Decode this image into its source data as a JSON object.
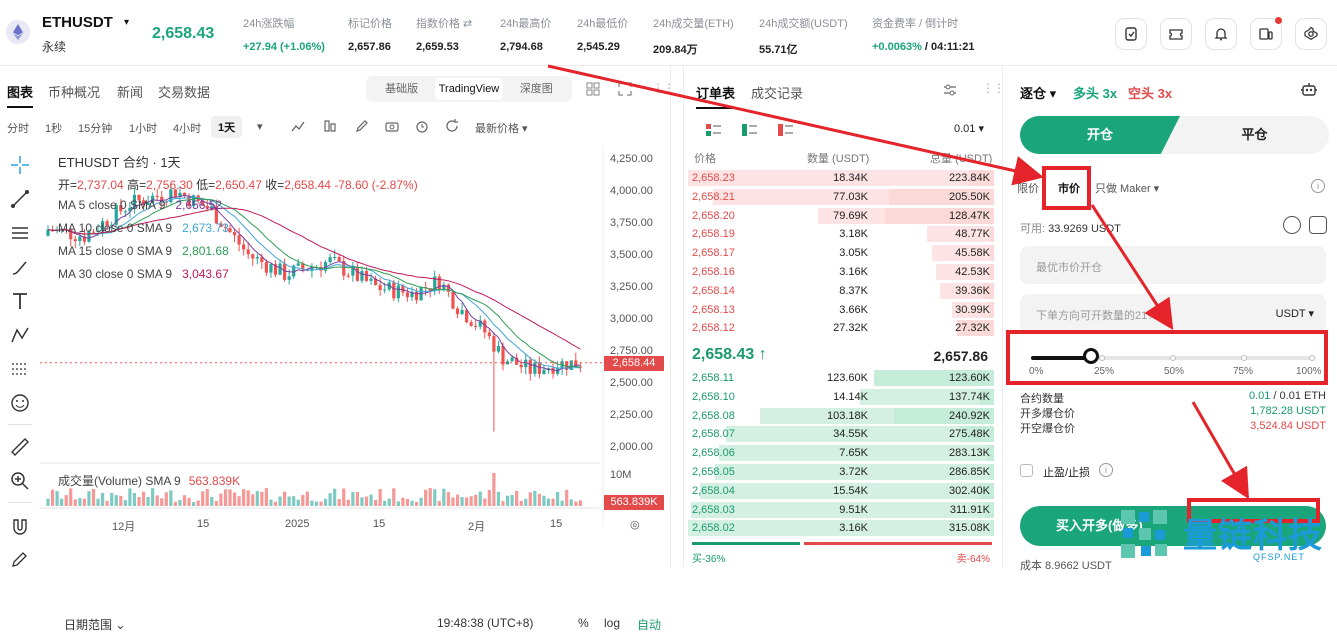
{
  "header": {
    "symbol": "ETHUSDT",
    "caret": "▾",
    "contract_type": "永续",
    "last_price": "2,658.43",
    "stats": [
      {
        "label": "24h涨跌幅",
        "value": "+27.94 (+1.06%)",
        "green": true
      },
      {
        "label": "标记价格",
        "value": "2,657.86"
      },
      {
        "label": "指数价格 ⇄",
        "value": "2,659.53"
      },
      {
        "label": "24h最高价",
        "value": "2,794.68"
      },
      {
        "label": "24h最低价",
        "value": "2,545.29"
      },
      {
        "label": "24h成交量(ETH)",
        "value": "209.84万"
      },
      {
        "label": "24h成交额(USDT)",
        "value": "55.71亿"
      },
      {
        "label": "资金费率 / 倒计时",
        "value_green": "+0.0063%",
        "value": " / 04:11:21"
      }
    ],
    "icons": [
      "note-icon",
      "ticket-icon",
      "bell-icon",
      "device-icon",
      "settings-icon"
    ]
  },
  "chart_tabs": {
    "tabs": [
      "图表",
      "币种概况",
      "新闻",
      "交易数据"
    ],
    "views": [
      "基础版",
      "TradingView",
      "深度图"
    ]
  },
  "timeframes": {
    "items": [
      "分时",
      "1秒",
      "15分钟",
      "1小时",
      "4小时",
      "1天"
    ],
    "active": "1天",
    "price_mode": "最新价格 ▾"
  },
  "chart": {
    "title": "ETHUSDT 合约 · 1天",
    "ohlc": {
      "o_label": "开=",
      "o": "2,737.04",
      "h_label": "高=",
      "h": "2,756.30",
      "l_label": "低=",
      "l": "2,650.47",
      "c_label": "收=",
      "c": "2,658.44",
      "chg": "-78.60 (-2.87%)"
    },
    "ma": [
      {
        "label": "MA 5 close 0 SMA 9",
        "value": "2,656.52",
        "color": "#7b3fa0"
      },
      {
        "label": "MA 10 close 0 SMA 9",
        "value": "2,673.73",
        "color": "#3fa6d8"
      },
      {
        "label": "MA 15 close 0 SMA 9",
        "value": "2,801.68",
        "color": "#2e9e57"
      },
      {
        "label": "MA 30 close 0 SMA 9",
        "value": "3,043.67",
        "color": "#c2185b"
      }
    ],
    "volume_label": "成交量(Volume) SMA 9",
    "volume_value": "563.839K",
    "y_labels": [
      "4,250.00",
      "4,000.00",
      "3,750.00",
      "3,500.00",
      "3,250.00",
      "3,000.00",
      "2,750.00",
      "2,500.00",
      "2,250.00",
      "2,000.00"
    ],
    "current_tag": "2,658.44",
    "vol_axis_label": "10M",
    "vol_tag": "563.839K",
    "x_labels": [
      "12月",
      "15",
      "2025",
      "15",
      "2月",
      "15"
    ],
    "date_range": "日期范围 ⌄",
    "clock": "19:48:38 (UTC+8)",
    "pct": "%",
    "log": "log",
    "auto": "自动"
  },
  "chart_data": {
    "type": "candlestick",
    "title": "ETHUSDT 合约 · 1天",
    "ylim": [
      2000,
      4250
    ],
    "x": [
      "12月",
      "15",
      "2025",
      "15",
      "2月",
      "15"
    ],
    "last": {
      "open": 2737.04,
      "high": 2756.3,
      "low": 2650.47,
      "close": 2658.44
    }
  },
  "orderbook": {
    "tabs": [
      "订单表",
      "成交记录"
    ],
    "tick": "0.01 ▾",
    "headers": [
      "价格",
      "数量 (USDT)",
      "总量 (USDT)"
    ],
    "asks": [
      {
        "p": "2,658.23",
        "q": "18.34K",
        "t": "223.84K"
      },
      {
        "p": "2,658.21",
        "q": "77.03K",
        "t": "205.50K"
      },
      {
        "p": "2,658.20",
        "q": "79.69K",
        "t": "128.47K"
      },
      {
        "p": "2,658.19",
        "q": "3.18K",
        "t": "48.77K"
      },
      {
        "p": "2,658.17",
        "q": "3.05K",
        "t": "45.58K"
      },
      {
        "p": "2,658.16",
        "q": "3.16K",
        "t": "42.53K"
      },
      {
        "p": "2,658.14",
        "q": "8.37K",
        "t": "39.36K"
      },
      {
        "p": "2,658.13",
        "q": "3.66K",
        "t": "30.99K"
      },
      {
        "p": "2,658.12",
        "q": "27.32K",
        "t": "27.32K"
      }
    ],
    "mid_price": "2,658.43 ↑",
    "mid_mark": "2,657.86",
    "bids": [
      {
        "p": "2,658.11",
        "q": "123.60K",
        "t": "123.60K"
      },
      {
        "p": "2,658.10",
        "q": "14.14K",
        "t": "137.74K"
      },
      {
        "p": "2,658.08",
        "q": "103.18K",
        "t": "240.92K"
      },
      {
        "p": "2,658.07",
        "q": "34.55K",
        "t": "275.48K"
      },
      {
        "p": "2,658.06",
        "q": "7.65K",
        "t": "283.13K"
      },
      {
        "p": "2,658.05",
        "q": "3.72K",
        "t": "286.85K"
      },
      {
        "p": "2,658.04",
        "q": "15.54K",
        "t": "302.40K"
      },
      {
        "p": "2,658.03",
        "q": "9.51K",
        "t": "311.91K"
      },
      {
        "p": "2,658.02",
        "q": "3.16K",
        "t": "315.08K"
      }
    ],
    "buy_ratio": "买-36%",
    "sell_ratio": "卖-64%",
    "buy_fraction": 0.36
  },
  "trade": {
    "mode": "逐仓 ▾",
    "lev_long": "多头 3x",
    "lev_short": "空头 3x",
    "open": "开仓",
    "close": "平仓",
    "order_types": [
      "限价",
      "市价",
      "只做 Maker ▾"
    ],
    "available_label": "可用:",
    "available_value": "33.9269 USDT",
    "price_placeholder": "最优市价开仓",
    "qty_placeholder": "下单方向可开数量的21%",
    "qty_unit": "USDT ▾",
    "slider_fraction": 0.21,
    "slider_marks": [
      "0%",
      "25%",
      "50%",
      "75%",
      "100%"
    ],
    "contract_qty_label": "合约数量",
    "contract_qty_a": "0.01",
    "contract_qty_b": " / 0.01 ETH",
    "long_liq_label": "开多爆仓价",
    "long_liq": "1,782.28 USDT",
    "short_liq_label": "开空爆仓价",
    "short_liq": "3,524.84 USDT",
    "tpsl": "止盈/止损",
    "buy_btn": "买入开多(做多)",
    "cost": "成本 8.9662 USDT"
  },
  "watermark": {
    "text": "量链科技",
    "sub": "QFSP.NET"
  },
  "colors": {
    "green": "#1aa57a",
    "red": "#e34a4a",
    "annotation": "#e4232a"
  }
}
